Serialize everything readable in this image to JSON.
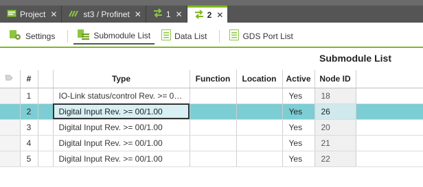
{
  "tabs": [
    {
      "label": "Project",
      "icon": "project-icon",
      "active": false
    },
    {
      "label": "st3 / Profinet",
      "icon": "profinet-icon",
      "active": false
    },
    {
      "label": "1",
      "icon": "arrows-icon",
      "active": false
    },
    {
      "label": "2",
      "icon": "arrows-icon",
      "active": true
    }
  ],
  "toolbar": {
    "settings": "Settings",
    "submodule_list": "Submodule List",
    "data_list": "Data List",
    "gds_port_list": "GDS Port List"
  },
  "title": "Submodule List",
  "table": {
    "headers": {
      "num": "#",
      "type": "Type",
      "function": "Function",
      "location": "Location",
      "active": "Active",
      "node_id": "Node ID"
    },
    "rows": [
      {
        "num": "1",
        "type": "IO-Link status/control Rev. >= 00/…",
        "function": "",
        "location": "",
        "active": "Yes",
        "node_id": "18",
        "selected": false
      },
      {
        "num": "2",
        "type": "Digital Input Rev. >= 00/1.00",
        "function": "",
        "location": "",
        "active": "Yes",
        "node_id": "26",
        "selected": true
      },
      {
        "num": "3",
        "type": "Digital Input Rev. >= 00/1.00",
        "function": "",
        "location": "",
        "active": "Yes",
        "node_id": "20",
        "selected": false
      },
      {
        "num": "4",
        "type": "Digital Input Rev. >= 00/1.00",
        "function": "",
        "location": "",
        "active": "Yes",
        "node_id": "21",
        "selected": false
      },
      {
        "num": "5",
        "type": "Digital Input Rev. >= 00/1.00",
        "function": "",
        "location": "",
        "active": "Yes",
        "node_id": "22",
        "selected": false
      }
    ]
  },
  "colors": {
    "accent_green": "#7fb81e",
    "selection_teal": "#7ccdd4",
    "tabbar_gray": "#555555"
  }
}
